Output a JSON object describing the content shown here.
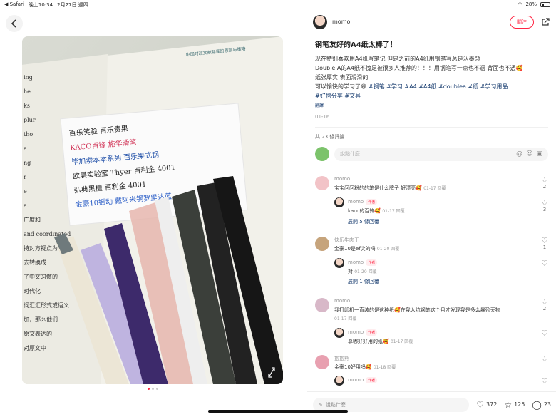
{
  "status": {
    "carrier": "◀ Safari",
    "time": "晚上10:34",
    "date": "2月27日 週四",
    "battery": "28%"
  },
  "author": {
    "name": "momo",
    "follow_label": "關注"
  },
  "post": {
    "title": "钢笔友好的A4纸太棒了！",
    "line1": "现在特别喜欢用A4纸写笔记 但是之前的A4纸用钢笔写总是洇墨😓",
    "line2": "Double A的A4纸不愧是被很多人推荐的！！！用钢笔写一点也不洇 背面也不透🥰",
    "line3": "纸张厚实 表面滑滑的",
    "line4_text": "可以愉快的学习了😆 ",
    "tags_inline": [
      "#钢笔",
      "#学习",
      "#A4",
      "#A4纸",
      "#doublea",
      "#纸",
      "#学习用品"
    ],
    "tags_line2": [
      "#好物分享",
      "#文具"
    ],
    "translate": "翻譯",
    "date": "01-16",
    "comment_count": "共 23 條評論",
    "comment_placeholder": "說點什麼..."
  },
  "comments": [
    {
      "name": "momo",
      "text": "宝宝问问粉的的笔是什么牌子 好漂亮🥰",
      "meta": "01-17 回覆",
      "likes": "2"
    },
    {
      "name": "momo",
      "badge": "作者",
      "text": "kaco的百锋🥰",
      "meta": "01-17 回覆",
      "likes": "3"
    },
    {
      "expand": "展開 5 條回覆"
    },
    {
      "name": "快乐牛肉干",
      "text": "金豪10是ef尖的吗",
      "meta": "01-20 回覆",
      "likes": "1"
    },
    {
      "name": "momo",
      "badge": "作者",
      "text": "对",
      "meta": "01-20 回覆",
      "likes": ""
    },
    {
      "expand": "展開 1 條回覆"
    },
    {
      "name": "momo",
      "text": "我打印机一直装的是这种纸🥰在我入坑钢笔这个月才发现我是多么暴殄天物",
      "meta": "01-17 回覆",
      "likes": "2"
    },
    {
      "name": "momo",
      "badge": "作者",
      "text": "尊嘟好好用的纸🥰",
      "meta": "01-17 回覆",
      "likes": ""
    },
    {
      "name": "抱抱熊",
      "text": "金豪10好用吗🥰",
      "meta": "01-18 回覆",
      "likes": ""
    },
    {
      "name": "momo",
      "badge": "作者",
      "text": "",
      "meta": "",
      "likes": ""
    }
  ],
  "bottom": {
    "placeholder": "說點什麼...",
    "likes": "372",
    "stars": "125",
    "comments": "23"
  },
  "photo": {
    "book_line": "中国时政文献翻译的原则与策略",
    "note_lines": [
      "百乐笑脸   百乐贵果",
      "KACO百锋   施华滑笔",
      "毕加索本本系列   百乐果式钢",
      "欧晨实验室 Thyer   百利金 4001",
      "弘典黑檀   百利金 4001",
      "金豪10摇动   戴阿米钢罗里达蓝"
    ],
    "book_side": [
      "ing",
      "he",
      "ks",
      "plur",
      "tho",
      "a",
      "ng",
      "r",
      "e",
      "a.",
      "广度和",
      "and coordinated",
      "持对方视点为",
      "去转换成",
      "了中文习惯的",
      "时代化",
      "词汇汇形式或语义",
      "加，那么他们",
      "原文表达的",
      "对原文中"
    ]
  },
  "icons": {
    "back": "back-icon",
    "share": "share-icon",
    "heart": "heart-icon",
    "star": "star-icon",
    "chat": "chat-icon",
    "at": "at-icon",
    "emoji": "emoji-icon",
    "image": "image-icon",
    "expand": "expand-icon"
  },
  "colors": {
    "accent": "#ff2442",
    "tag": "#13386c"
  }
}
